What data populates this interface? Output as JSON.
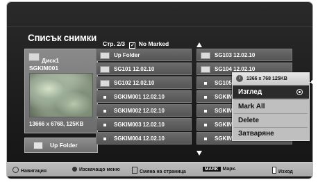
{
  "window": {
    "title": "Списък снимки"
  },
  "paging": {
    "page_label": "Стр. 2/3",
    "marked_label": "No Marked"
  },
  "preview": {
    "drive": "Диск1",
    "filename": "SGKIM001",
    "info": "13666 x 6768, 125KB",
    "up_folder": "Up Folder"
  },
  "files": {
    "left": [
      {
        "label": "Up Folder",
        "icon": "up-folder-icon"
      },
      {
        "label": "SG101 12.02.10",
        "icon": "folder-icon"
      },
      {
        "label": "SG102 12.02.10",
        "icon": "folder-icon"
      },
      {
        "label": "SGKIM001 12.02.10",
        "icon": "photo-icon"
      },
      {
        "label": "SGKIM002 12.02.10",
        "icon": "photo-icon"
      },
      {
        "label": "SGKIM003 12.02.10",
        "icon": "photo-icon"
      },
      {
        "label": "SGKIM004 12.02.10",
        "icon": "photo-icon"
      }
    ],
    "right": [
      {
        "label": "SG103 12.02.10",
        "icon": "folder-icon"
      },
      {
        "label": "SG104 12.02.10",
        "icon": "folder-icon"
      },
      {
        "label": "SG105 12.02.10",
        "icon": "photo-icon"
      },
      {
        "label": "SGKIM005 12.02.10",
        "icon": "photo-icon"
      },
      {
        "label": "SGKIM006 12.02.10",
        "icon": "photo-icon"
      },
      {
        "label": "SGKIM007 12.02.10",
        "icon": "photo-icon"
      },
      {
        "label": "SGKIM008 12.02.10",
        "icon": "photo-icon"
      }
    ]
  },
  "popup": {
    "info": "1366 x 768  125KB",
    "items": [
      {
        "label": "Изглед",
        "selected": true
      },
      {
        "label": "Mark All",
        "selected": false
      },
      {
        "label": "Delete",
        "selected": false
      },
      {
        "label": "Затваряне",
        "selected": false
      }
    ]
  },
  "footer": {
    "navigation": "Навигация",
    "popup_menu": "Изскачащо меню",
    "page_change": "Смяна на страница",
    "mark_key": "MARK",
    "mark_label": "Марк.",
    "exit_label": "Изход"
  },
  "colors": {
    "background": "#1c1c1c",
    "cell": "#606060",
    "popup": "#bfbfbf",
    "selected": "#2b2b2b"
  }
}
